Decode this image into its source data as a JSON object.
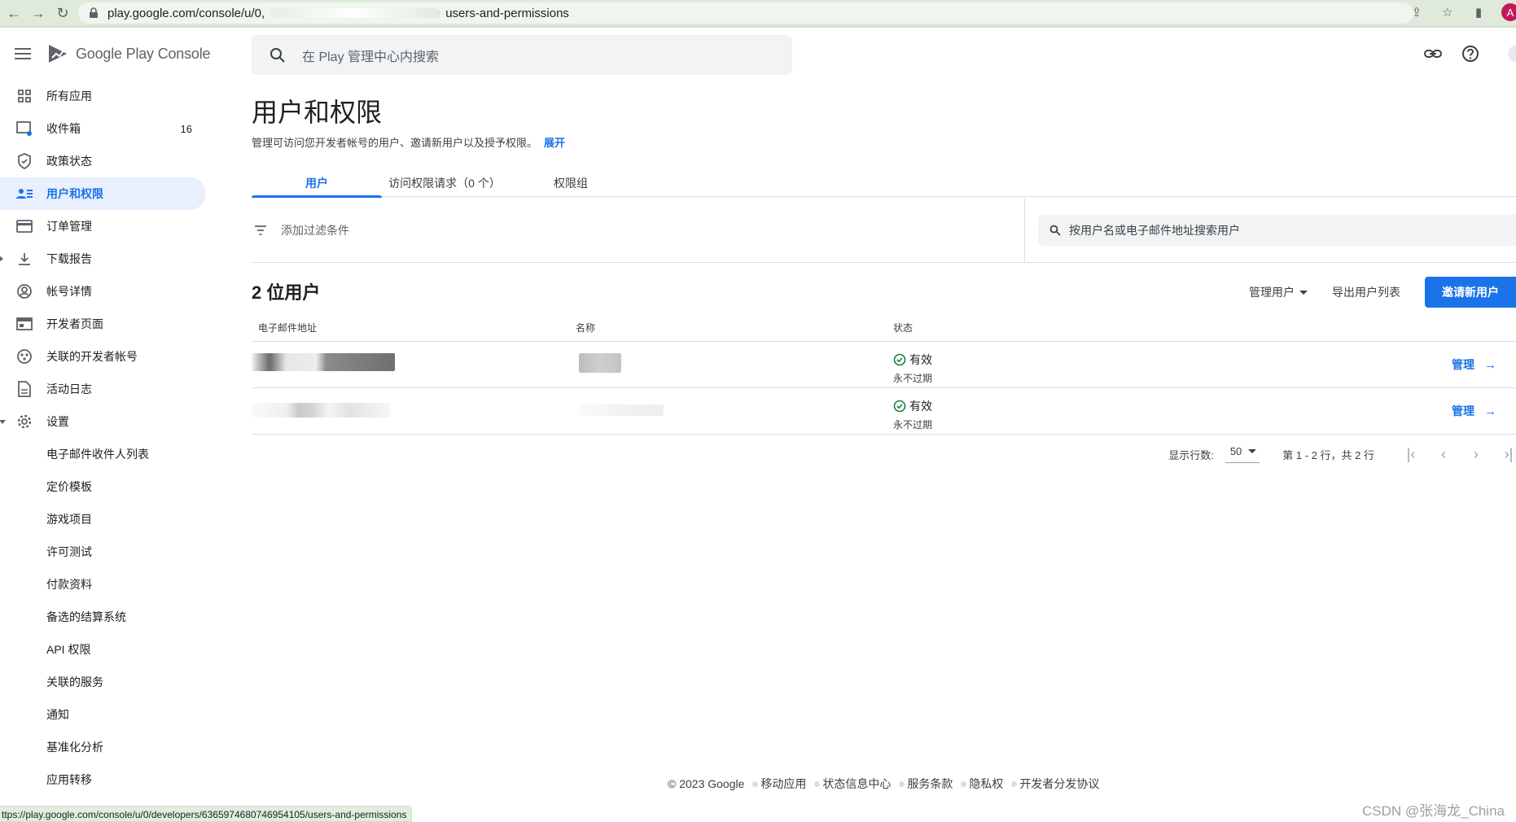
{
  "browser": {
    "url_start": "play.google.com/console/u/0,",
    "url_end": "users-and-permissions",
    "profile_initial": "A",
    "status_url": "ttps://play.google.com/console/u/0/developers/6365974680746954105/users-and-permissions"
  },
  "app": {
    "name": "Google Play",
    "name_suffix": "Console",
    "search_placeholder": "在 Play 管理中心内搜索"
  },
  "sidebar": {
    "items": [
      {
        "label": "所有应用",
        "icon": "grid-icon"
      },
      {
        "label": "收件箱",
        "icon": "inbox-icon",
        "badge": "16"
      },
      {
        "label": "政策状态",
        "icon": "shield-icon"
      },
      {
        "label": "用户和权限",
        "icon": "users-icon"
      },
      {
        "label": "订单管理",
        "icon": "credit-card-icon"
      },
      {
        "label": "下载报告",
        "icon": "download-icon"
      },
      {
        "label": "帐号详情",
        "icon": "account-icon"
      },
      {
        "label": "开发者页面",
        "icon": "page-icon"
      },
      {
        "label": "关联的开发者帐号",
        "icon": "linked-icon"
      },
      {
        "label": "活动日志",
        "icon": "log-icon"
      },
      {
        "label": "设置",
        "icon": "gear-icon"
      }
    ],
    "settings_sub": [
      "电子邮件收件人列表",
      "定价模板",
      "游戏项目",
      "许可测试",
      "付款资料",
      "备选的结算系统",
      "API 权限",
      "关联的服务",
      "通知",
      "基准化分析",
      "应用转移"
    ]
  },
  "page": {
    "title": "用户和权限",
    "description": "管理可访问您开发者帐号的用户、邀请新用户以及授予权限。",
    "expand_link": "展开",
    "tabs": [
      "用户",
      "访问权限请求（0 个）",
      "权限组"
    ],
    "filter_label": "添加过滤条件",
    "user_search_placeholder": "按用户名或电子邮件地址搜索用户",
    "count_title": "2 位用户",
    "manage_users": "管理用户",
    "export_users": "导出用户列表",
    "invite_button": "邀请新用户"
  },
  "table": {
    "headers": [
      "电子邮件地址",
      "名称",
      "状态"
    ],
    "rows": [
      {
        "status": "有效",
        "expiry": "永不过期",
        "action": "管理"
      },
      {
        "status": "有效",
        "expiry": "永不过期",
        "action": "管理"
      }
    ]
  },
  "pagination": {
    "rows_label": "显示行数:",
    "rows_value": "50",
    "range": "第 1 - 2 行，共 2 行"
  },
  "footer": {
    "copyright": "© 2023 Google",
    "links": [
      "移动应用",
      "状态信息中心",
      "服务条款",
      "隐私权",
      "开发者分发协议"
    ]
  },
  "watermark": "CSDN @张海龙_China",
  "colors": {
    "accent": "#1a73e8",
    "success": "#188038"
  }
}
